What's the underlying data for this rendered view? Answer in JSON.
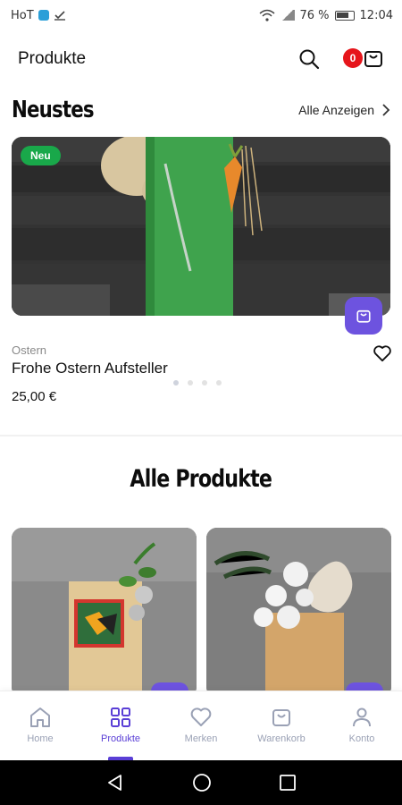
{
  "status_bar": {
    "carrier": "HoT",
    "battery_percent": "76 %",
    "time": "12:04"
  },
  "app_bar": {
    "title": "Produkte",
    "cart_count": "0"
  },
  "newest": {
    "title": "Neustes",
    "see_all_label": "Alle Anzeigen",
    "featured": {
      "badge": "Neu",
      "category": "Ostern",
      "name": "Frohe Ostern Aufsteller",
      "price": "25,00 €",
      "carousel_total": 4,
      "carousel_active": 1
    }
  },
  "all_products": {
    "title": "Alle Produkte"
  },
  "bottom_nav": {
    "items": [
      {
        "label": "Home",
        "icon": "home-icon"
      },
      {
        "label": "Produkte",
        "icon": "grid-icon",
        "active": true
      },
      {
        "label": "Merken",
        "icon": "heart-icon"
      },
      {
        "label": "Warenkorb",
        "icon": "shopping-bag-icon"
      },
      {
        "label": "Konto",
        "icon": "user-icon"
      }
    ]
  },
  "colors": {
    "accent": "#6d53df",
    "badge_new": "#19a84a",
    "cart_badge": "#e6151b",
    "nav_active": "#5a3fd6",
    "nav_inactive": "#9aa1b5"
  }
}
